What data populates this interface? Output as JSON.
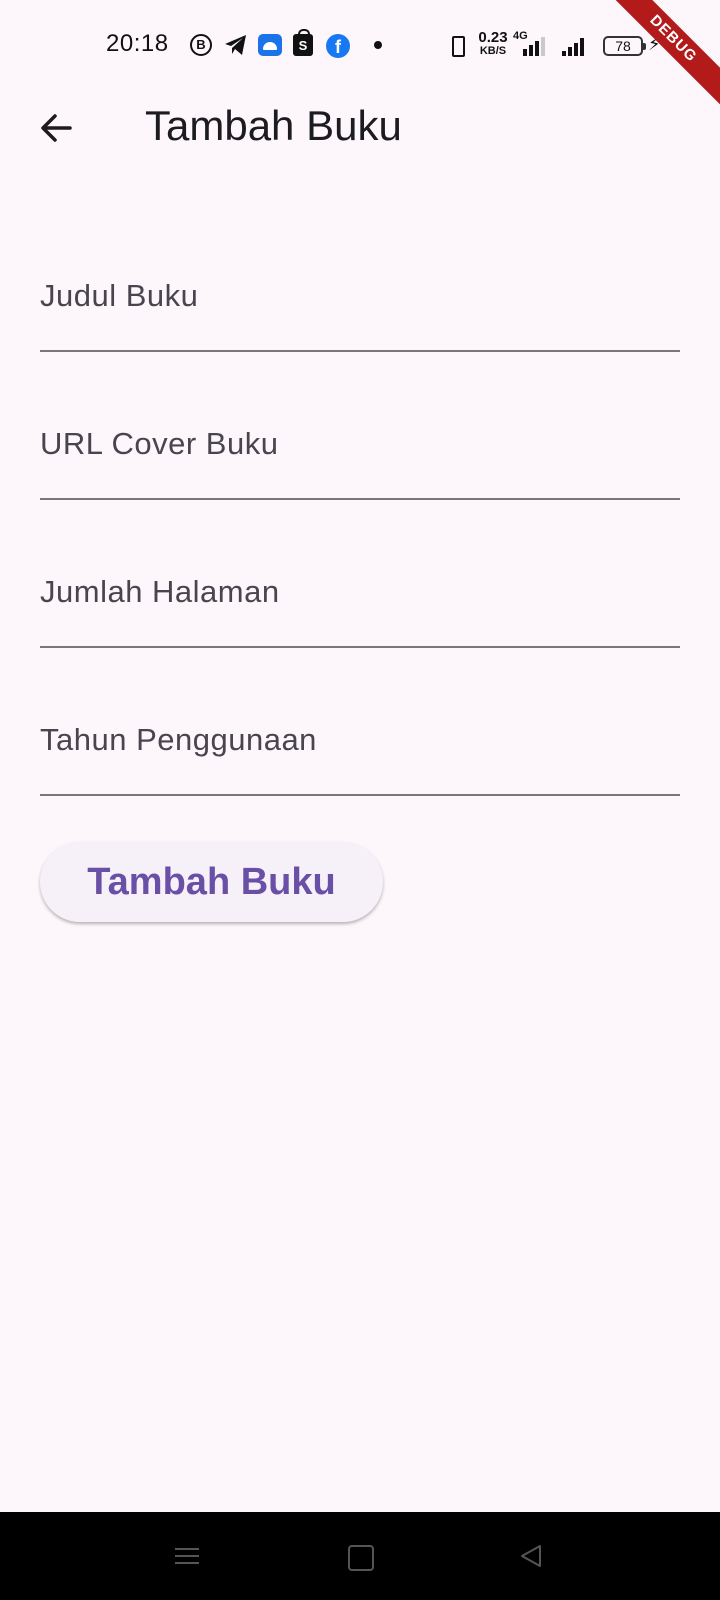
{
  "status_bar": {
    "time": "20:18",
    "notifications": [
      "b-icon",
      "telegram-icon",
      "android-icon",
      "shopee-icon",
      "facebook-icon",
      "dot-icon"
    ],
    "b_label": "B",
    "shop_label": "S",
    "fb_label": "f",
    "net_speed_value": "0.23",
    "net_speed_unit": "KB/S",
    "network_type": "4G",
    "battery_level": "78"
  },
  "debug_banner": {
    "label": "DEBUG",
    "color": "#b31b1b"
  },
  "app_bar": {
    "title": "Tambah Buku"
  },
  "form": {
    "fields": [
      {
        "label": "Judul Buku",
        "value": ""
      },
      {
        "label": "URL Cover Buku",
        "value": ""
      },
      {
        "label": "Jumlah Halaman",
        "value": ""
      },
      {
        "label": "Tahun Penggunaan",
        "value": ""
      }
    ],
    "submit_label": "Tambah Buku"
  },
  "colors": {
    "background": "#fdf7fc",
    "accent": "#6a4fa6",
    "button_bg": "#f6f1f8",
    "underline": "#7a767c"
  },
  "nav_bar": {
    "icons": [
      "menu-icon",
      "home-icon",
      "back-triangle-icon"
    ]
  }
}
